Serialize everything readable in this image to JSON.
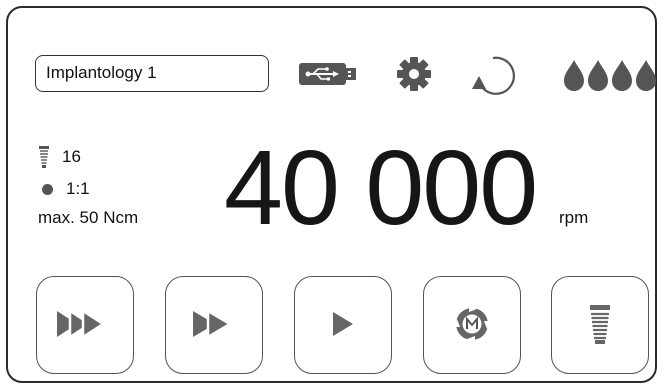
{
  "header": {
    "program_name": "Implantology 1",
    "icons": [
      "usb-icon",
      "gear-icon",
      "rotation-direction-icon",
      "irrigation-drops-icon"
    ],
    "irrigation_level": 4
  },
  "info": {
    "screw_value": "16",
    "gear_ratio": "1:1",
    "torque": "max. 50 Ncm"
  },
  "speed": {
    "value": "40 000",
    "unit": "rpm"
  },
  "buttons": {
    "icons": [
      "triple-chevron-icon",
      "double-chevron-icon",
      "play-icon",
      "m-mode-icon",
      "screw-icon"
    ]
  },
  "colors": {
    "icon_gray": "#555555",
    "border": "#2b2b2b"
  }
}
